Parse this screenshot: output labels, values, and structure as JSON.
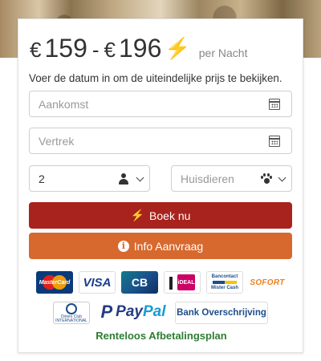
{
  "price": {
    "currency": "€",
    "min": "159",
    "separator": "-",
    "max": "196",
    "bolt": "⚡",
    "per_label": "per Nacht"
  },
  "hint": "Voer de datum in om de uiteindelijke prijs te bekijken.",
  "fields": {
    "arrival_placeholder": "Aankomst",
    "departure_placeholder": "Vertrek",
    "guests_value": "2",
    "pets_placeholder": "Huisdieren"
  },
  "buttons": {
    "book_label": "Boek nu",
    "info_label": "Info Aanvraag"
  },
  "payment_methods": {
    "mastercard": "MasterCard",
    "visa": "VISA",
    "cb": "CB",
    "ideal": "iDEAL",
    "bancontact_top": "Bancontact",
    "bancontact_bottom": "Mister Cash",
    "sofort": "SOFORT",
    "diners_line1": "Diners Club",
    "diners_line2": "INTERNATIONAL",
    "paypal_a": "Pay",
    "paypal_b": "Pal",
    "bank_transfer": "Bank Overschrijving"
  },
  "installment_label": "Renteloos Afbetalingsplan",
  "colors": {
    "book_button": "#a8231d",
    "info_button": "#d7692f",
    "bolt": "#f2c311",
    "installment_text": "#2e7d32"
  },
  "icons": [
    "calendar-icon",
    "user-icon",
    "chevron-down-icon",
    "paw-icon",
    "bolt-icon",
    "info-icon"
  ]
}
